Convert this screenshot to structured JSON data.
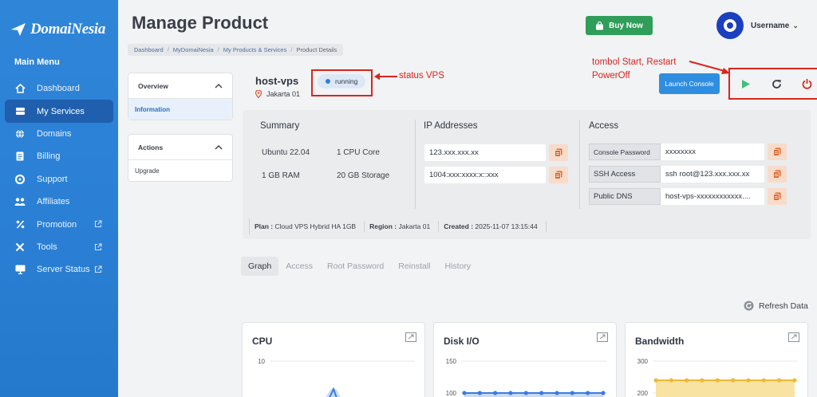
{
  "brand": {
    "name": "DomaiNesia"
  },
  "sidebar": {
    "title": "Main Menu",
    "items": [
      {
        "label": "Dashboard",
        "icon": "home-icon"
      },
      {
        "label": "My Services",
        "icon": "server-icon"
      },
      {
        "label": "Domains",
        "icon": "globe-icon"
      },
      {
        "label": "Billing",
        "icon": "document-icon"
      },
      {
        "label": "Support",
        "icon": "lifebuoy-icon"
      },
      {
        "label": "Affiliates",
        "icon": "people-icon"
      },
      {
        "label": "Promotion",
        "icon": "percent-icon"
      },
      {
        "label": "Tools",
        "icon": "tools-icon"
      },
      {
        "label": "Server Status",
        "icon": "monitor-icon"
      }
    ]
  },
  "header": {
    "title": "Manage Product",
    "buy_label": "Buy Now",
    "username": "Username"
  },
  "breadcrumb": [
    "Dashboard",
    "MyDomaiNesia",
    "My Products & Services",
    "Product Details"
  ],
  "panels": {
    "overview": {
      "title": "Overview",
      "items": [
        "Information"
      ]
    },
    "actions": {
      "title": "Actions",
      "items": [
        "Upgrade"
      ]
    }
  },
  "host": {
    "name": "host-vps",
    "location": "Jakarta 01",
    "status": "running",
    "launch_label": "Launch Console"
  },
  "annotations": {
    "status": "status VPS",
    "power_line1": "tombol Start, Restart",
    "power_line2": "PowerOff"
  },
  "summary": {
    "title": "Summary",
    "os": "Ubuntu 22.04",
    "cpu": "1 CPU Core",
    "ram": "1 GB RAM",
    "storage": "20 GB Storage"
  },
  "ip": {
    "title": "IP Addresses",
    "ipv4": "123.xxx.xxx.xx",
    "ipv6": "1004:xxx:xxxx:x::xxx"
  },
  "access": {
    "title": "Access",
    "rows": [
      {
        "label": "Console Password",
        "value": "xxxxxxxx"
      },
      {
        "label": "SSH Access",
        "value": "ssh root@123.xxx.xxx.xx"
      },
      {
        "label": "Public DNS",
        "value": "host-vps-xxxxxxxxxxxx...."
      }
    ]
  },
  "meta": {
    "plan_label": "Plan :",
    "plan": "Cloud VPS Hybrid HA 1GB",
    "region_label": "Region :",
    "region": "Jakarta 01",
    "created_label": "Created :",
    "created": "2025-11-07 13:15:44"
  },
  "tabs": [
    "Graph",
    "Access",
    "Root Password",
    "Reinstall",
    "History"
  ],
  "refresh_label": "Refresh Data",
  "colors": {
    "sidebar": "#2a7fd4",
    "accent": "#2f8ee0",
    "buy": "#2f9e5a",
    "annotation": "#d9251d"
  },
  "chart_data": [
    {
      "type": "line",
      "title": "CPU",
      "yticks": [
        "10"
      ]
    },
    {
      "type": "area",
      "title": "Disk I/O",
      "yticks": [
        "150",
        "100"
      ],
      "values": [
        100,
        100,
        100,
        100,
        100,
        100,
        100,
        100,
        100,
        100
      ]
    },
    {
      "type": "area",
      "title": "Bandwidth",
      "yticks": [
        "300",
        "200"
      ],
      "values": [
        240,
        240,
        240,
        240,
        240,
        240,
        240,
        240,
        240,
        240
      ]
    }
  ]
}
